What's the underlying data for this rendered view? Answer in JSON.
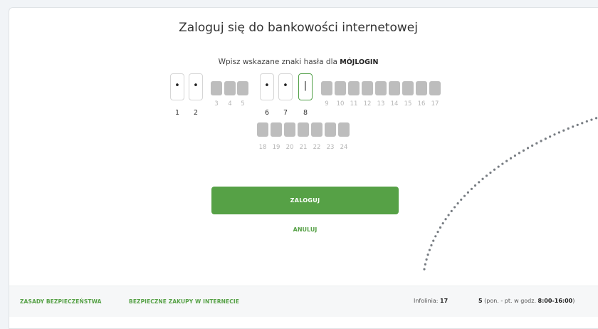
{
  "page": {
    "title": "Zaloguj się do bankowości internetowej",
    "instruction_prefix": "Wpisz wskazane znaki hasła dla ",
    "instruction_login": "MÓJLOGIN"
  },
  "password": {
    "positions": [
      {
        "n": "1",
        "enabled": true,
        "value": "•"
      },
      {
        "n": "2",
        "enabled": true,
        "value": "•"
      },
      {
        "n": "3",
        "enabled": false
      },
      {
        "n": "4",
        "enabled": false
      },
      {
        "n": "5",
        "enabled": false
      },
      {
        "n": "6",
        "enabled": true,
        "value": "•"
      },
      {
        "n": "7",
        "enabled": true,
        "value": "•"
      },
      {
        "n": "8",
        "enabled": true,
        "value": "|",
        "active": true
      },
      {
        "n": "9",
        "enabled": false
      },
      {
        "n": "10",
        "enabled": false
      },
      {
        "n": "11",
        "enabled": false
      },
      {
        "n": "12",
        "enabled": false
      },
      {
        "n": "13",
        "enabled": false
      },
      {
        "n": "14",
        "enabled": false
      },
      {
        "n": "15",
        "enabled": false
      },
      {
        "n": "16",
        "enabled": false
      },
      {
        "n": "17",
        "enabled": false
      },
      {
        "n": "18",
        "enabled": false
      },
      {
        "n": "19",
        "enabled": false
      },
      {
        "n": "20",
        "enabled": false
      },
      {
        "n": "21",
        "enabled": false
      },
      {
        "n": "22",
        "enabled": false
      },
      {
        "n": "23",
        "enabled": false
      },
      {
        "n": "24",
        "enabled": false
      }
    ]
  },
  "actions": {
    "login_label": "ZALOGUJ",
    "cancel_label": "ANULUJ"
  },
  "footer": {
    "security_rules": "ZASADY BEZPIECZEŃSTWA",
    "safe_shopping": "BEZPIECZNE ZAKUPY W INTERNECIE",
    "hotline_label": "Infolinia: ",
    "hotline_number": "17",
    "hours_number": "5",
    "hours_text": " (pon. - pt. w godz. ",
    "hours_time": "8:00-16:00",
    "hours_close": ")"
  },
  "colors": {
    "accent": "#56a146",
    "disabled_box": "#bdbdbd"
  }
}
